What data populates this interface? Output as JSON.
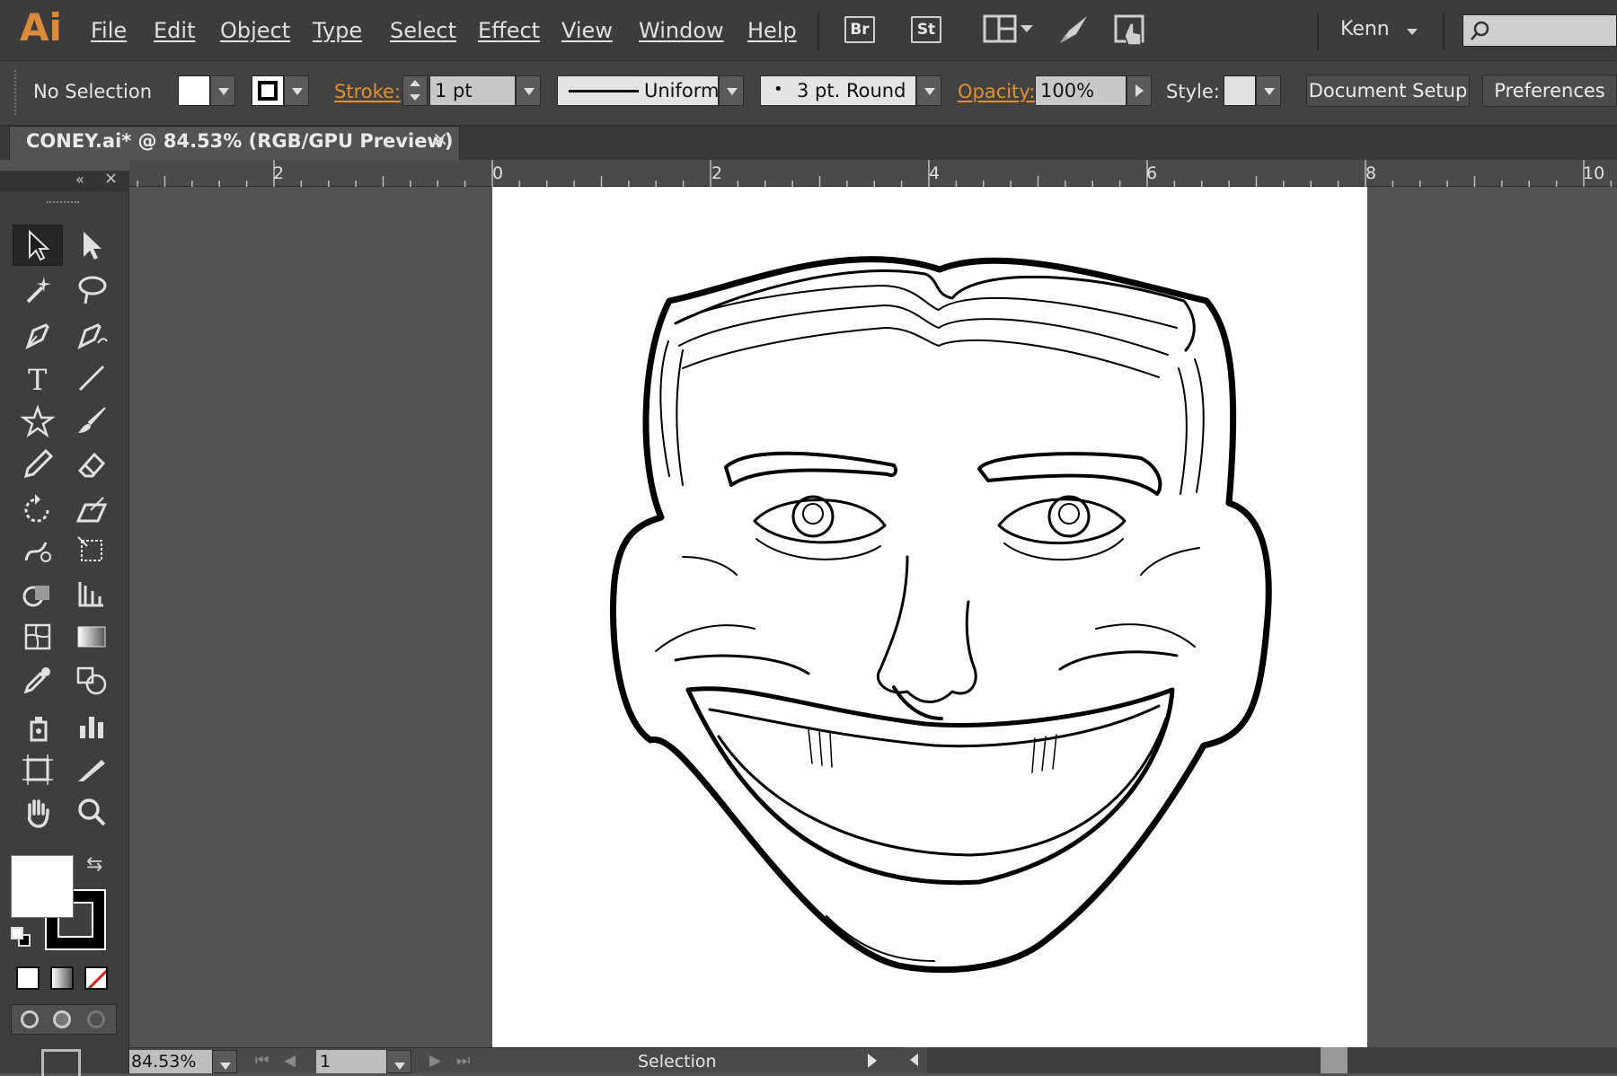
{
  "app": {
    "logo": "Ai"
  },
  "menu": [
    "File",
    "Edit",
    "Object",
    "Type",
    "Select",
    "Effect",
    "View",
    "Window",
    "Help"
  ],
  "bridge_buttons": [
    "Br",
    "St"
  ],
  "user": {
    "name": "Kenn"
  },
  "control": {
    "selection": "No Selection",
    "stroke_label": "Stroke:",
    "stroke_weight": "1 pt",
    "profile_label": "Uniform",
    "brush_label": "3 pt. Round",
    "opacity_label": "Opacity:",
    "opacity_value": "100%",
    "style_label": "Style:",
    "document_setup": "Document Setup",
    "preferences": "Preferences"
  },
  "tab": {
    "title": "CONEY.ai* @ 84.53% (RGB/GPU Preview)",
    "close": "×"
  },
  "ruler_labels": [
    "2",
    "0",
    "2",
    "4",
    "6",
    "8",
    "10"
  ],
  "status": {
    "zoom": "84.53%",
    "page": "1",
    "tool": "Selection"
  },
  "colors": {
    "accent": "#d98a3a",
    "chrome": "#424242",
    "pasteboard": "#535353"
  }
}
